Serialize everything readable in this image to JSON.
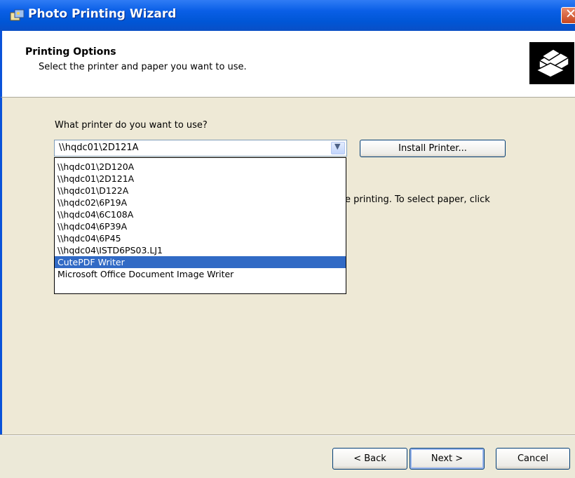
{
  "window": {
    "title": "Photo Printing Wizard"
  },
  "header": {
    "title": "Printing Options",
    "subtitle": "Select the printer and paper you want to use."
  },
  "printer": {
    "question": "What printer do you want to use?",
    "selected": "\\\\hqdc01\\2D121A",
    "install_label": "Install Printer...",
    "options": [
      "\\\\hqdc01\\2D120A",
      "\\\\hqdc01\\2D121A",
      "\\\\hqdc01\\D122A",
      "\\\\hqdc02\\6P19A",
      "\\\\hqdc04\\6C108A",
      "\\\\hqdc04\\6P39A",
      "\\\\hqdc04\\6P45",
      "\\\\hqdc04\\ISTD6PS03.LJ1",
      "CutePDF Writer",
      "Microsoft Office Document Image Writer"
    ],
    "highlighted_option": "CutePDF Writer"
  },
  "paper": {
    "partial_text": "e printing. To select paper, click"
  },
  "footer": {
    "back_label": "< Back",
    "next_label": "Next >",
    "cancel_label": "Cancel"
  },
  "colors": {
    "titlebar": "#0a5fe6",
    "selection": "#316ac5",
    "dialog_bg": "#ece9d8"
  },
  "icons": [
    "photo-wizard-icon",
    "close-icon",
    "printer-icon",
    "dropdown-arrow-icon"
  ]
}
